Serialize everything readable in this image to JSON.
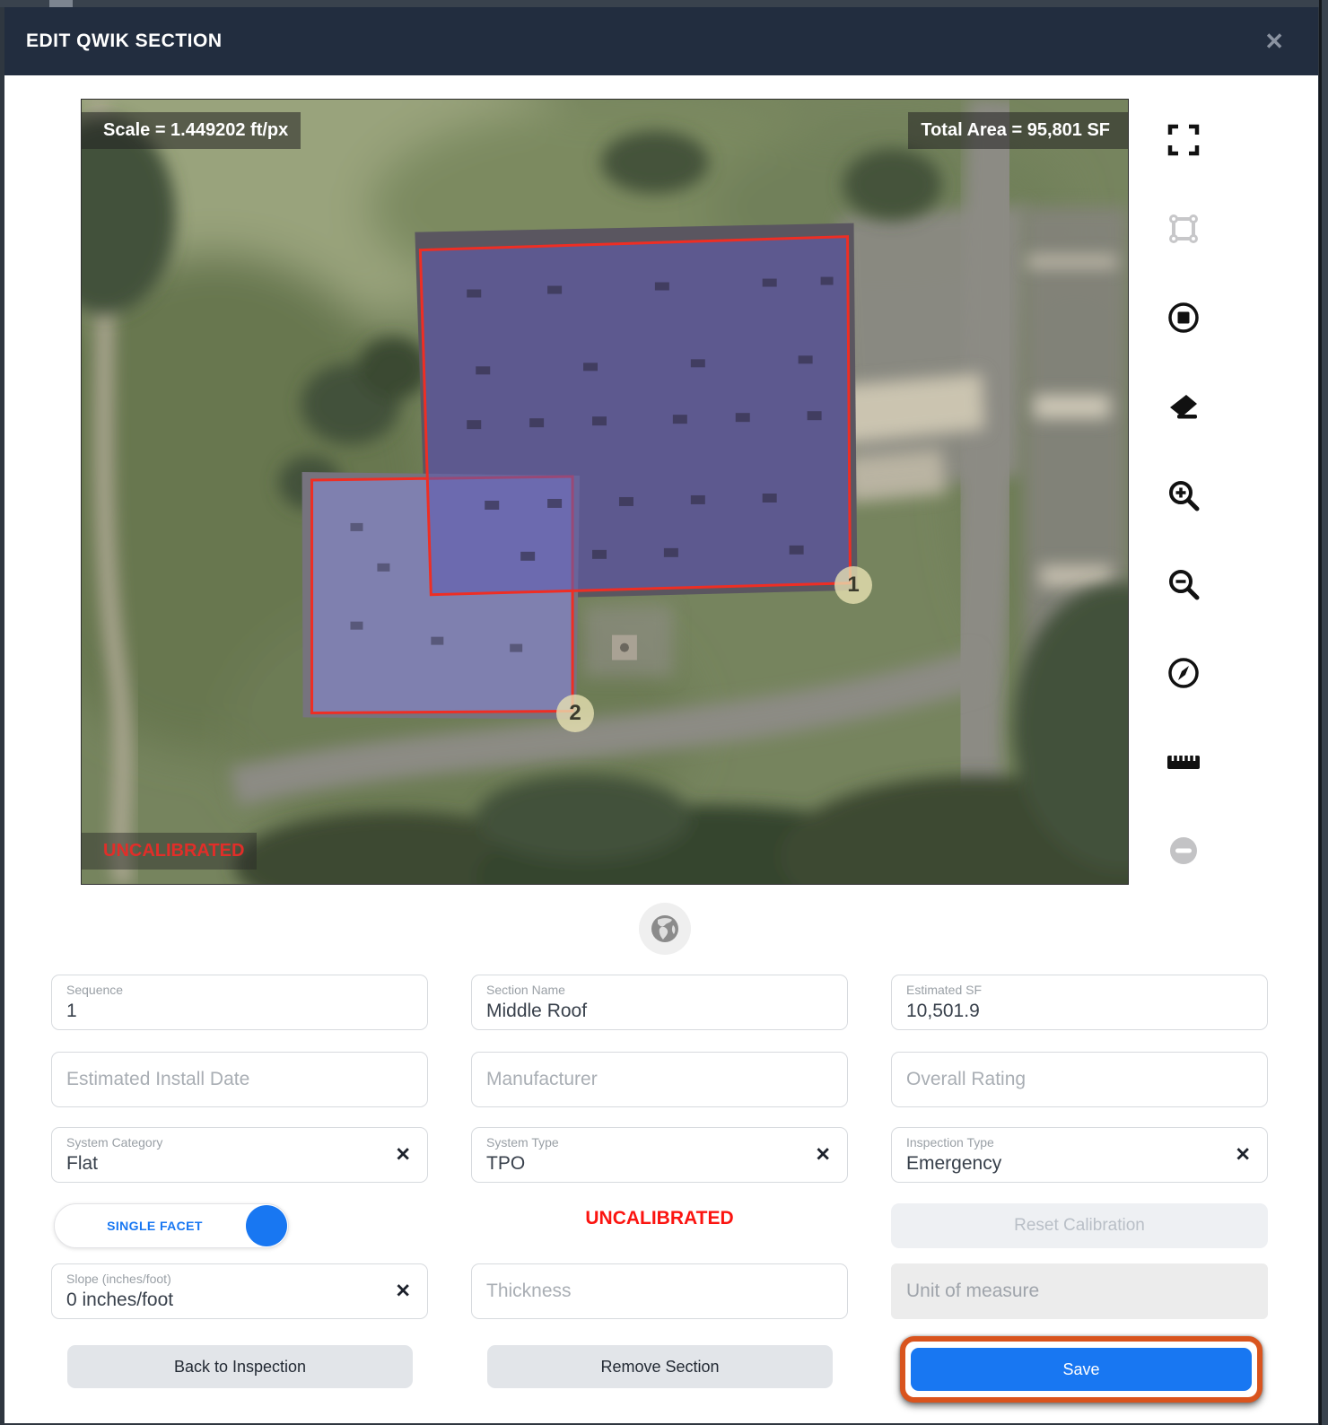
{
  "header": {
    "title": "EDIT QWIK SECTION",
    "close_icon": "✕"
  },
  "map": {
    "scale_label": "Scale = 1.449202 ft/px",
    "total_area_label": "Total Area = 95,801 SF",
    "uncalibrated_label": "UNCALIBRATED",
    "markers": {
      "first": "1",
      "second": "2"
    },
    "toolbar_icons": [
      "fullscreen",
      "polygon-vertices",
      "stop-draw",
      "eraser",
      "zoom-in",
      "zoom-out",
      "compass",
      "ruler",
      "remove-vertex"
    ]
  },
  "form": {
    "sequence": {
      "label": "Sequence",
      "value": "1"
    },
    "section_name": {
      "label": "Section Name",
      "value": "Middle Roof"
    },
    "estimated_sf": {
      "label": "Estimated SF",
      "value": "10,501.9"
    },
    "estimated_install_date": {
      "placeholder": "Estimated Install Date"
    },
    "manufacturer": {
      "placeholder": "Manufacturer"
    },
    "overall_rating": {
      "placeholder": "Overall Rating"
    },
    "system_category": {
      "label": "System Category",
      "value": "Flat"
    },
    "system_type": {
      "label": "System Type",
      "value": "TPO"
    },
    "inspection_type": {
      "label": "Inspection Type",
      "value": "Emergency"
    },
    "slope": {
      "label": "Slope (inches/foot)",
      "value": "0 inches/foot"
    },
    "thickness": {
      "placeholder": "Thickness"
    },
    "unit_of_measure": {
      "placeholder": "Unit of measure"
    },
    "single_facet_label": "SINGLE FACET",
    "uncalibrated_label": "UNCALIBRATED",
    "reset_calibration_label": "Reset Calibration"
  },
  "buttons": {
    "back_label": "Back to Inspection",
    "remove_label": "Remove Section",
    "save_label": "Save"
  },
  "glyphs": {
    "clear": "✕"
  },
  "colors": {
    "accent_blue": "#1877f2",
    "annotation_orange": "#d9541e",
    "alert_red": "#fb1410",
    "header_navy": "#222d3f",
    "overlay_purple": "#5f5caf",
    "polygon_border_red": "#ee2e24"
  }
}
